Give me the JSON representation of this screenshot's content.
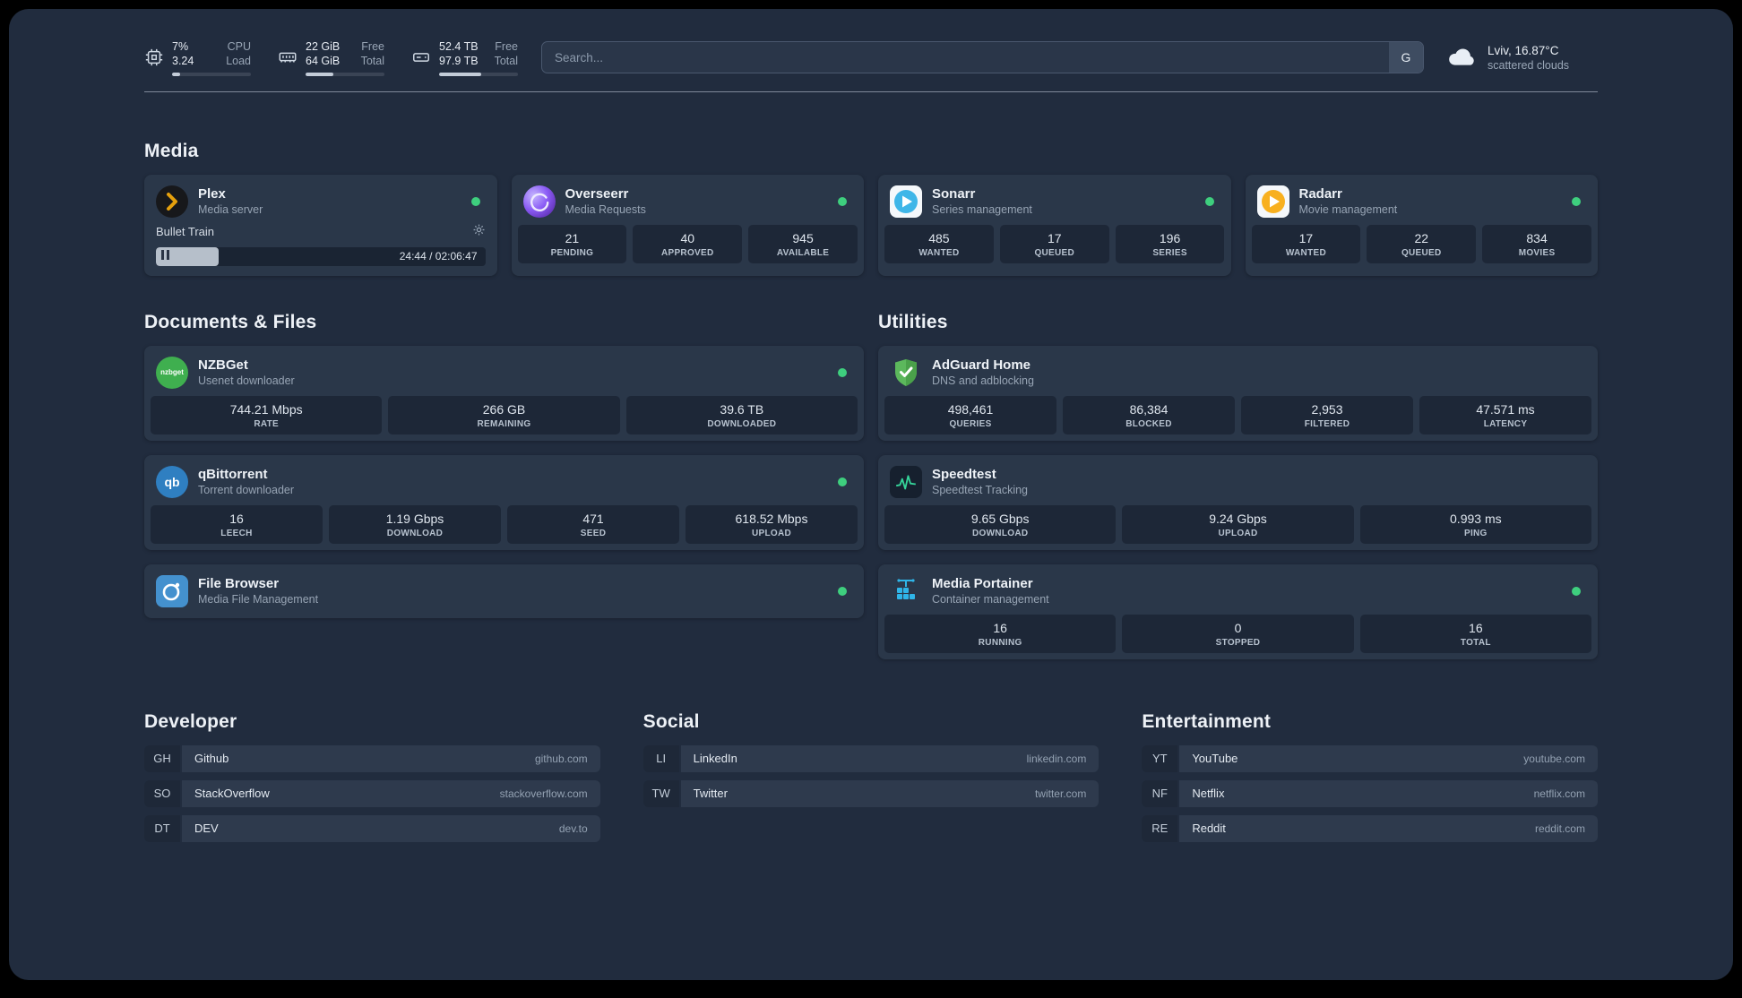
{
  "topbar": {
    "resources": [
      {
        "icon": "cpu-icon",
        "v1": "7%",
        "l1": "CPU",
        "v2": "3.24",
        "l2": "Load",
        "pct": 10
      },
      {
        "icon": "memory-icon",
        "v1": "22 GiB",
        "l1": "Free",
        "v2": "64 GiB",
        "l2": "Total",
        "pct": 35
      },
      {
        "icon": "disk-icon",
        "v1": "52.4 TB",
        "l1": "Free",
        "v2": "97.9 TB",
        "l2": "Total",
        "pct": 53
      }
    ],
    "search": {
      "placeholder": "Search...",
      "provider_label": "G"
    },
    "weather": {
      "location": "Lviv, 16.87°C",
      "condition": "scattered clouds"
    }
  },
  "media": {
    "title": "Media",
    "plex": {
      "name": "Plex",
      "desc": "Media server",
      "now_playing": "Bullet Train",
      "time": "24:44 / 02:06:47",
      "progress_pct": 19
    },
    "overseerr": {
      "name": "Overseerr",
      "desc": "Media Requests",
      "stats": [
        {
          "v": "21",
          "l": "PENDING"
        },
        {
          "v": "40",
          "l": "APPROVED"
        },
        {
          "v": "945",
          "l": "AVAILABLE"
        }
      ]
    },
    "sonarr": {
      "name": "Sonarr",
      "desc": "Series management",
      "stats": [
        {
          "v": "485",
          "l": "WANTED"
        },
        {
          "v": "17",
          "l": "QUEUED"
        },
        {
          "v": "196",
          "l": "SERIES"
        }
      ]
    },
    "radarr": {
      "name": "Radarr",
      "desc": "Movie management",
      "stats": [
        {
          "v": "17",
          "l": "WANTED"
        },
        {
          "v": "22",
          "l": "QUEUED"
        },
        {
          "v": "834",
          "l": "MOVIES"
        }
      ]
    }
  },
  "documents": {
    "title": "Documents & Files",
    "nzbget": {
      "name": "NZBGet",
      "desc": "Usenet downloader",
      "stats": [
        {
          "v": "744.21 Mbps",
          "l": "RATE"
        },
        {
          "v": "266 GB",
          "l": "REMAINING"
        },
        {
          "v": "39.6 TB",
          "l": "DOWNLOADED"
        }
      ]
    },
    "qbittorrent": {
      "name": "qBittorrent",
      "desc": "Torrent downloader",
      "stats": [
        {
          "v": "16",
          "l": "LEECH"
        },
        {
          "v": "1.19 Gbps",
          "l": "DOWNLOAD"
        },
        {
          "v": "471",
          "l": "SEED"
        },
        {
          "v": "618.52 Mbps",
          "l": "UPLOAD"
        }
      ]
    },
    "filebrowser": {
      "name": "File Browser",
      "desc": "Media File Management"
    }
  },
  "utilities": {
    "title": "Utilities",
    "adguard": {
      "name": "AdGuard Home",
      "desc": "DNS and adblocking",
      "stats": [
        {
          "v": "498,461",
          "l": "QUERIES"
        },
        {
          "v": "86,384",
          "l": "BLOCKED"
        },
        {
          "v": "2,953",
          "l": "FILTERED"
        },
        {
          "v": "47.571 ms",
          "l": "LATENCY"
        }
      ]
    },
    "speedtest": {
      "name": "Speedtest",
      "desc": "Speedtest Tracking",
      "stats": [
        {
          "v": "9.65 Gbps",
          "l": "DOWNLOAD"
        },
        {
          "v": "9.24 Gbps",
          "l": "UPLOAD"
        },
        {
          "v": "0.993 ms",
          "l": "PING"
        }
      ]
    },
    "portainer": {
      "name": "Media Portainer",
      "desc": "Container management",
      "stats": [
        {
          "v": "16",
          "l": "RUNNING"
        },
        {
          "v": "0",
          "l": "STOPPED"
        },
        {
          "v": "16",
          "l": "TOTAL"
        }
      ]
    }
  },
  "bookmarks": {
    "developer": {
      "title": "Developer",
      "items": [
        {
          "abbr": "GH",
          "name": "Github",
          "url": "github.com"
        },
        {
          "abbr": "SO",
          "name": "StackOverflow",
          "url": "stackoverflow.com"
        },
        {
          "abbr": "DT",
          "name": "DEV",
          "url": "dev.to"
        }
      ]
    },
    "social": {
      "title": "Social",
      "items": [
        {
          "abbr": "LI",
          "name": "LinkedIn",
          "url": "linkedin.com"
        },
        {
          "abbr": "TW",
          "name": "Twitter",
          "url": "twitter.com"
        }
      ]
    },
    "entertainment": {
      "title": "Entertainment",
      "items": [
        {
          "abbr": "YT",
          "name": "YouTube",
          "url": "youtube.com"
        },
        {
          "abbr": "NF",
          "name": "Netflix",
          "url": "netflix.com"
        },
        {
          "abbr": "RE",
          "name": "Reddit",
          "url": "reddit.com"
        }
      ]
    }
  },
  "colors": {
    "status_online": "#3ecf7e",
    "accent_plex": "#e5a00d"
  }
}
